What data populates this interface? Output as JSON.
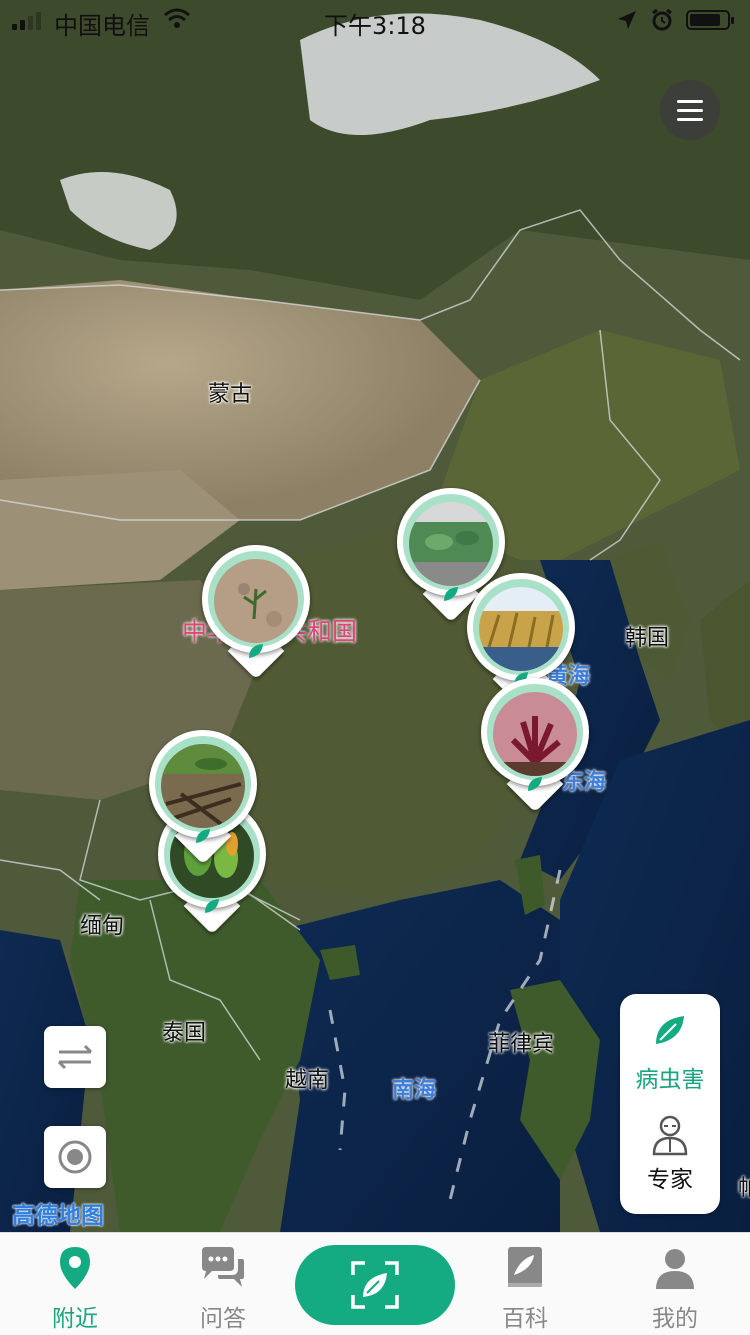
{
  "status_bar": {
    "carrier": "中国电信",
    "time": "下午3:18"
  },
  "map": {
    "labels": {
      "mongolia": "蒙古",
      "china": "中华人民共和国",
      "korea": "韩国",
      "yellow_sea": "黄海",
      "east_sea": "东海",
      "myanmar": "缅甸",
      "thailand": "泰国",
      "vietnam": "越南",
      "south_sea": "南海",
      "philippines": "菲律宾",
      "edge": "帕"
    },
    "logo": "高德地图"
  },
  "pins": [
    {
      "name": "pin-northwest",
      "photo": "dry-soil-seedling"
    },
    {
      "name": "pin-north",
      "photo": "green-leaves"
    },
    {
      "name": "pin-east-1",
      "photo": "wheat-field"
    },
    {
      "name": "pin-east-2",
      "photo": "red-plant"
    },
    {
      "name": "pin-southwest-1",
      "photo": "dry-branches"
    },
    {
      "name": "pin-southwest-2",
      "photo": "pepper-plant"
    }
  ],
  "side_panel": {
    "pest_label": "病虫害",
    "expert_label": "专家"
  },
  "tabbar": {
    "tabs": [
      {
        "label": "附近",
        "icon": "location-pin-icon",
        "active": true
      },
      {
        "label": "问答",
        "icon": "chat-bubbles-icon",
        "active": false
      },
      {
        "label": "百科",
        "icon": "book-icon",
        "active": false
      },
      {
        "label": "我的",
        "icon": "person-icon",
        "active": false
      }
    ],
    "scan_icon": "scan-leaf-icon"
  },
  "colors": {
    "accent": "#14ab82",
    "active_tab": "#1aa67d",
    "sea_label": "#3d7fd8",
    "country_label": "#e0457a"
  }
}
